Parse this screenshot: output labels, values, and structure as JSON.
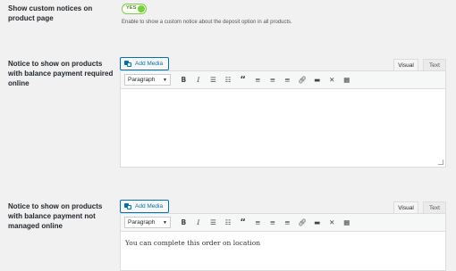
{
  "setting_custom_notices": {
    "label": "Show custom notices on product page",
    "toggle_label": "YES",
    "toggle_on": true,
    "description": "Enable to show a custom notice about the deposit option in all products."
  },
  "editor_required": {
    "label": "Notice to show on products with balance payment required online",
    "add_media": "Add Media",
    "tab_visual": "Visual",
    "tab_text": "Text",
    "format": "Paragraph",
    "content": ""
  },
  "editor_not_managed": {
    "label": "Notice to show on products with balance payment not managed online",
    "add_media": "Add Media",
    "tab_visual": "Visual",
    "tab_text": "Text",
    "format": "Paragraph",
    "content": "You can complete this order on location"
  },
  "toolbar_icons": [
    "bold-icon",
    "italic-icon",
    "bullet-list-icon",
    "numbered-list-icon",
    "blockquote-icon",
    "align-left-icon",
    "align-center-icon",
    "align-right-icon",
    "link-icon",
    "read-more-icon",
    "fullscreen-icon",
    "toolbar-toggle-icon"
  ],
  "colors": {
    "accent": "#0073aa",
    "toggle_on": "#7ad03a",
    "background": "#f1f1f1"
  }
}
